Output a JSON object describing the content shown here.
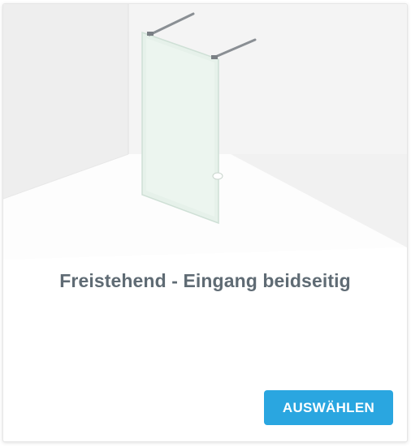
{
  "card": {
    "title": "Freistehend - Eingang beidseitig",
    "button_label": "AUSWÄHLEN",
    "illustration": "freestanding-glass-shower-wall",
    "accent_color": "#2aa6e0",
    "title_color": "#5f6b74"
  }
}
